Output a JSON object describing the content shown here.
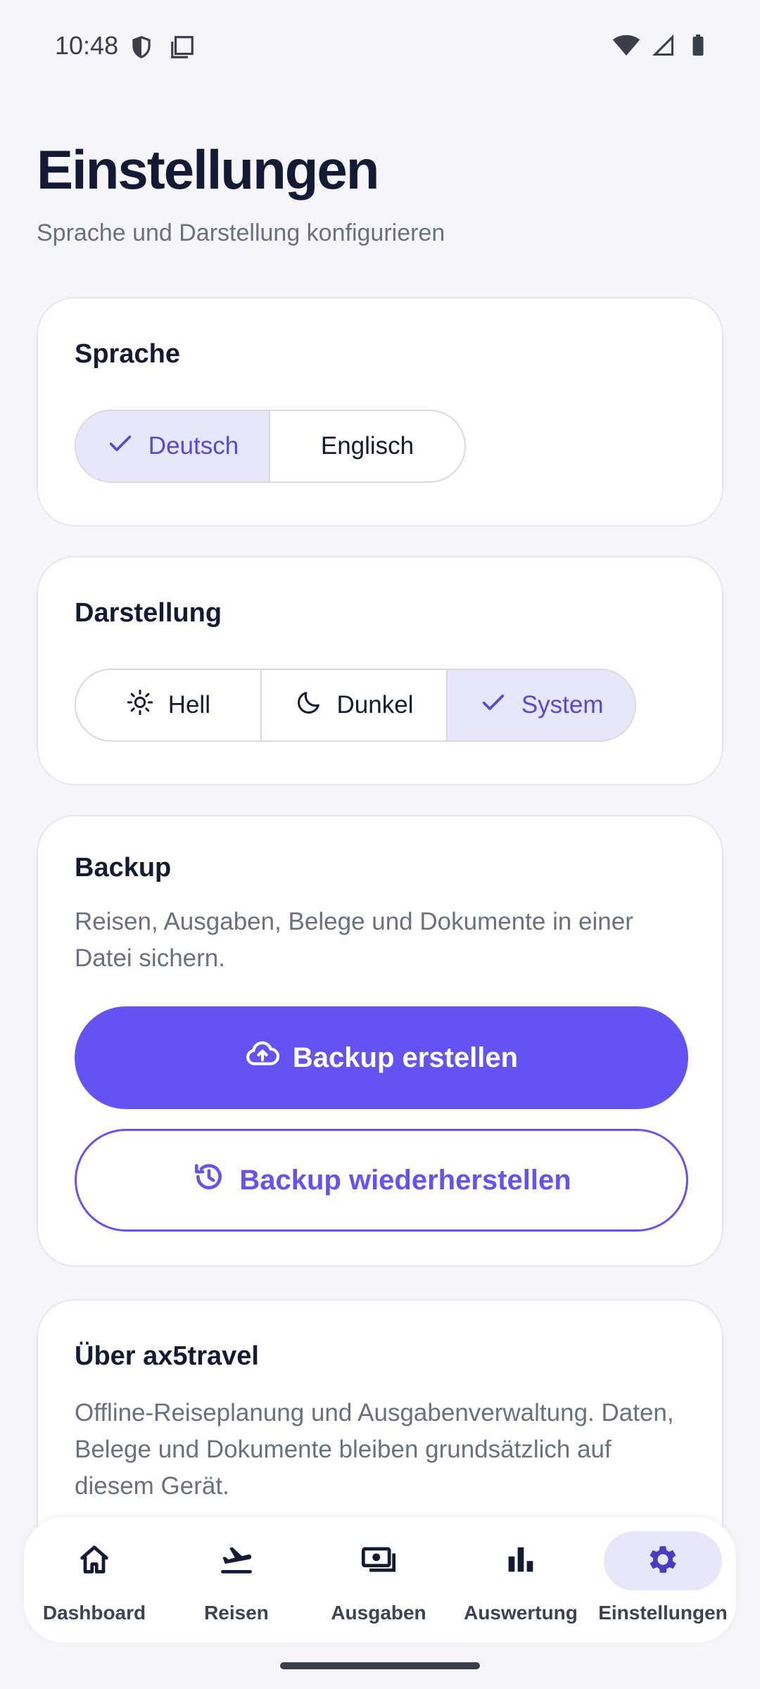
{
  "status_bar": {
    "time": "10:48",
    "left_icons": [
      "shield-icon",
      "screenshot-icon"
    ],
    "right_icons": [
      "wifi-icon",
      "signal-icon",
      "battery-icon"
    ]
  },
  "header": {
    "title": "Einstellungen",
    "subtitle": "Sprache und Darstellung konfigurieren"
  },
  "language_card": {
    "title": "Sprache",
    "options": [
      {
        "label": "Deutsch",
        "selected": true,
        "icon": "check-icon"
      },
      {
        "label": "Englisch",
        "selected": false
      }
    ]
  },
  "appearance_card": {
    "title": "Darstellung",
    "options": [
      {
        "label": "Hell",
        "selected": false,
        "icon": "sun-icon"
      },
      {
        "label": "Dunkel",
        "selected": false,
        "icon": "moon-icon"
      },
      {
        "label": "System",
        "selected": true,
        "icon": "check-icon"
      }
    ]
  },
  "backup_card": {
    "title": "Backup",
    "description": "Reisen, Ausgaben, Belege und Dokumente in einer Datei sichern.",
    "create_label": "Backup erstellen",
    "create_icon": "cloud-upload-icon",
    "restore_label": "Backup wiederherstellen",
    "restore_icon": "history-icon"
  },
  "about_card": {
    "title": "Über ax5travel",
    "description": "Offline-Reiseplanung und Ausgabenverwaltung. Daten, Belege und Dokumente bleiben grundsätzlich auf diesem Gerät."
  },
  "bottom_nav": {
    "items": [
      {
        "label": "Dashboard",
        "icon": "home-icon",
        "active": false
      },
      {
        "label": "Reisen",
        "icon": "flight-takeoff-icon",
        "active": false
      },
      {
        "label": "Ausgaben",
        "icon": "payments-icon",
        "active": false
      },
      {
        "label": "Auswertung",
        "icon": "bar-chart-icon",
        "active": false
      },
      {
        "label": "Einstellungen",
        "icon": "gear-icon",
        "active": true
      }
    ]
  },
  "colors": {
    "accent": "#6452f2",
    "accent_light": "#e8e6fb",
    "background": "#f6f6fa",
    "text_primary": "#141a33",
    "text_secondary": "#6b7080"
  }
}
